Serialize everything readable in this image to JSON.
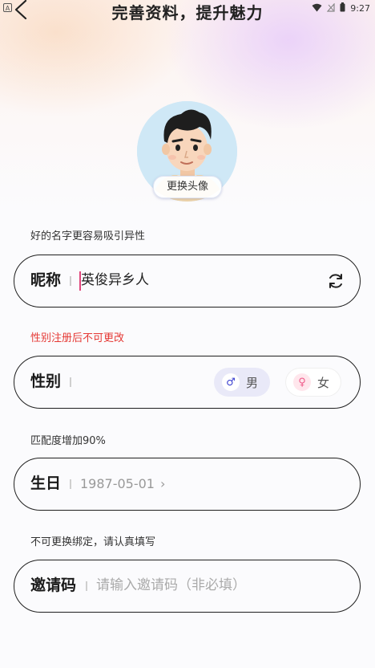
{
  "status_bar": {
    "time": "9:27",
    "left_icon": "a-icon",
    "icons": [
      "wifi-icon",
      "signal-icon",
      "battery-icon"
    ]
  },
  "header": {
    "title": "完善资料，提升魅力",
    "back_icon": "chevron-left-icon"
  },
  "avatar": {
    "change_label": "更换头像"
  },
  "form": {
    "nickname": {
      "hint": "好的名字更容易吸引异性",
      "label": "昵称",
      "value": "英俊异乡人",
      "refresh_icon": "refresh-icon"
    },
    "gender": {
      "hint": "性别注册后不可更改",
      "hint_color": "#e53935",
      "label": "性别",
      "options": [
        {
          "label": "男",
          "symbol": "♂",
          "selected": true
        },
        {
          "label": "女",
          "symbol": "♀",
          "selected": false
        }
      ]
    },
    "birthday": {
      "hint": "匹配度增加90%",
      "label": "生日",
      "value": "1987-05-01",
      "chevron": "›"
    },
    "invite": {
      "hint": "不可更换绑定，请认真填写",
      "label": "邀请码",
      "placeholder": "请输入邀请码（非必填）"
    }
  },
  "colors": {
    "accent_male": "#3a3fd0",
    "accent_female": "#ef5b8a",
    "border": "#1f1f1f"
  }
}
